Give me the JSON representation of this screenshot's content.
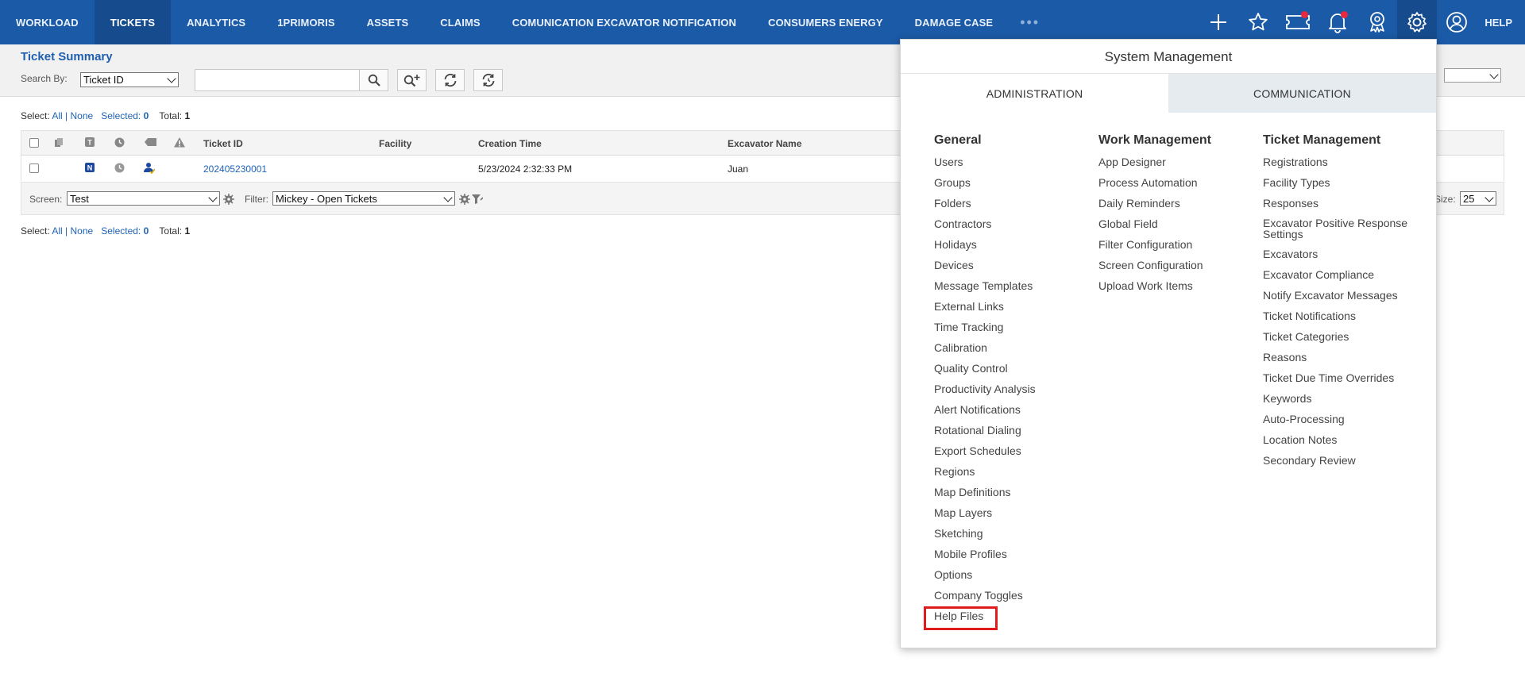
{
  "nav": {
    "items": [
      "WORKLOAD",
      "TICKETS",
      "ANALYTICS",
      "1PRIMORIS",
      "ASSETS",
      "CLAIMS",
      "COMUNICATION EXCAVATOR NOTIFICATION",
      "CONSUMERS ENERGY",
      "DAMAGE CASE"
    ],
    "active": "TICKETS",
    "more": "•••",
    "help": "HELP",
    "icons": [
      "plus-icon",
      "star-icon",
      "ticket-icon",
      "bell-icon",
      "award-icon",
      "gear-icon",
      "user-icon"
    ]
  },
  "summary": {
    "title": "Ticket Summary",
    "search_by_label": "Search By:",
    "search_by_value": "Ticket ID",
    "search_value": ""
  },
  "selection": {
    "select_label": "Select:",
    "all": "All",
    "sep": "|",
    "none": "None",
    "selected_label": "Selected:",
    "selected_count": "0",
    "total_label": "Total:",
    "total_count": "1"
  },
  "grid": {
    "columns": [
      "Ticket ID",
      "Facility",
      "Creation Time",
      "Excavator Name"
    ],
    "rows": [
      {
        "ticket_id": "202405230001",
        "facility": "",
        "creation_time": "5/23/2024 2:32:33 PM",
        "excavator_name": "Juan"
      }
    ],
    "screen_label": "Screen:",
    "screen_value": "Test",
    "filter_label": "Filter:",
    "filter_value": "Mickey - Open Tickets",
    "size_label": "Size:",
    "size_value": "25"
  },
  "panel": {
    "title": "System Management",
    "tabs": [
      "ADMINISTRATION",
      "COMMUNICATION"
    ],
    "general": {
      "heading": "General",
      "items": [
        "Users",
        "Groups",
        "Folders",
        "Contractors",
        "Holidays",
        "Devices",
        "Message Templates",
        "External Links",
        "Time Tracking",
        "Calibration",
        "Quality Control",
        "Productivity Analysis",
        "Alert Notifications",
        "Rotational Dialing",
        "Export Schedules",
        "Regions",
        "Map Definitions",
        "Map Layers",
        "Sketching",
        "Mobile Profiles",
        "Options",
        "Company Toggles",
        "Help Files"
      ]
    },
    "work": {
      "heading": "Work Management",
      "items": [
        "App Designer",
        "Process Automation",
        "Daily Reminders",
        "Global Field",
        "Filter Configuration",
        "Screen Configuration",
        "Upload Work Items"
      ]
    },
    "ticket": {
      "heading": "Ticket Management",
      "items": [
        "Registrations",
        "Facility Types",
        "Responses",
        "Excavator Positive Response Settings",
        "Excavators",
        "Excavator Compliance",
        "Notify Excavator Messages",
        "Ticket Notifications",
        "Ticket Categories",
        "Reasons",
        "Ticket Due Time Overrides",
        "Keywords",
        "Auto-Processing",
        "Location Notes",
        "Secondary Review"
      ]
    }
  },
  "colors": {
    "nav_bg": "#1b5aa6",
    "nav_active": "#164c8e",
    "link": "#1f63b5",
    "badge": "#e8283c",
    "highlight": "#e01b1b"
  }
}
